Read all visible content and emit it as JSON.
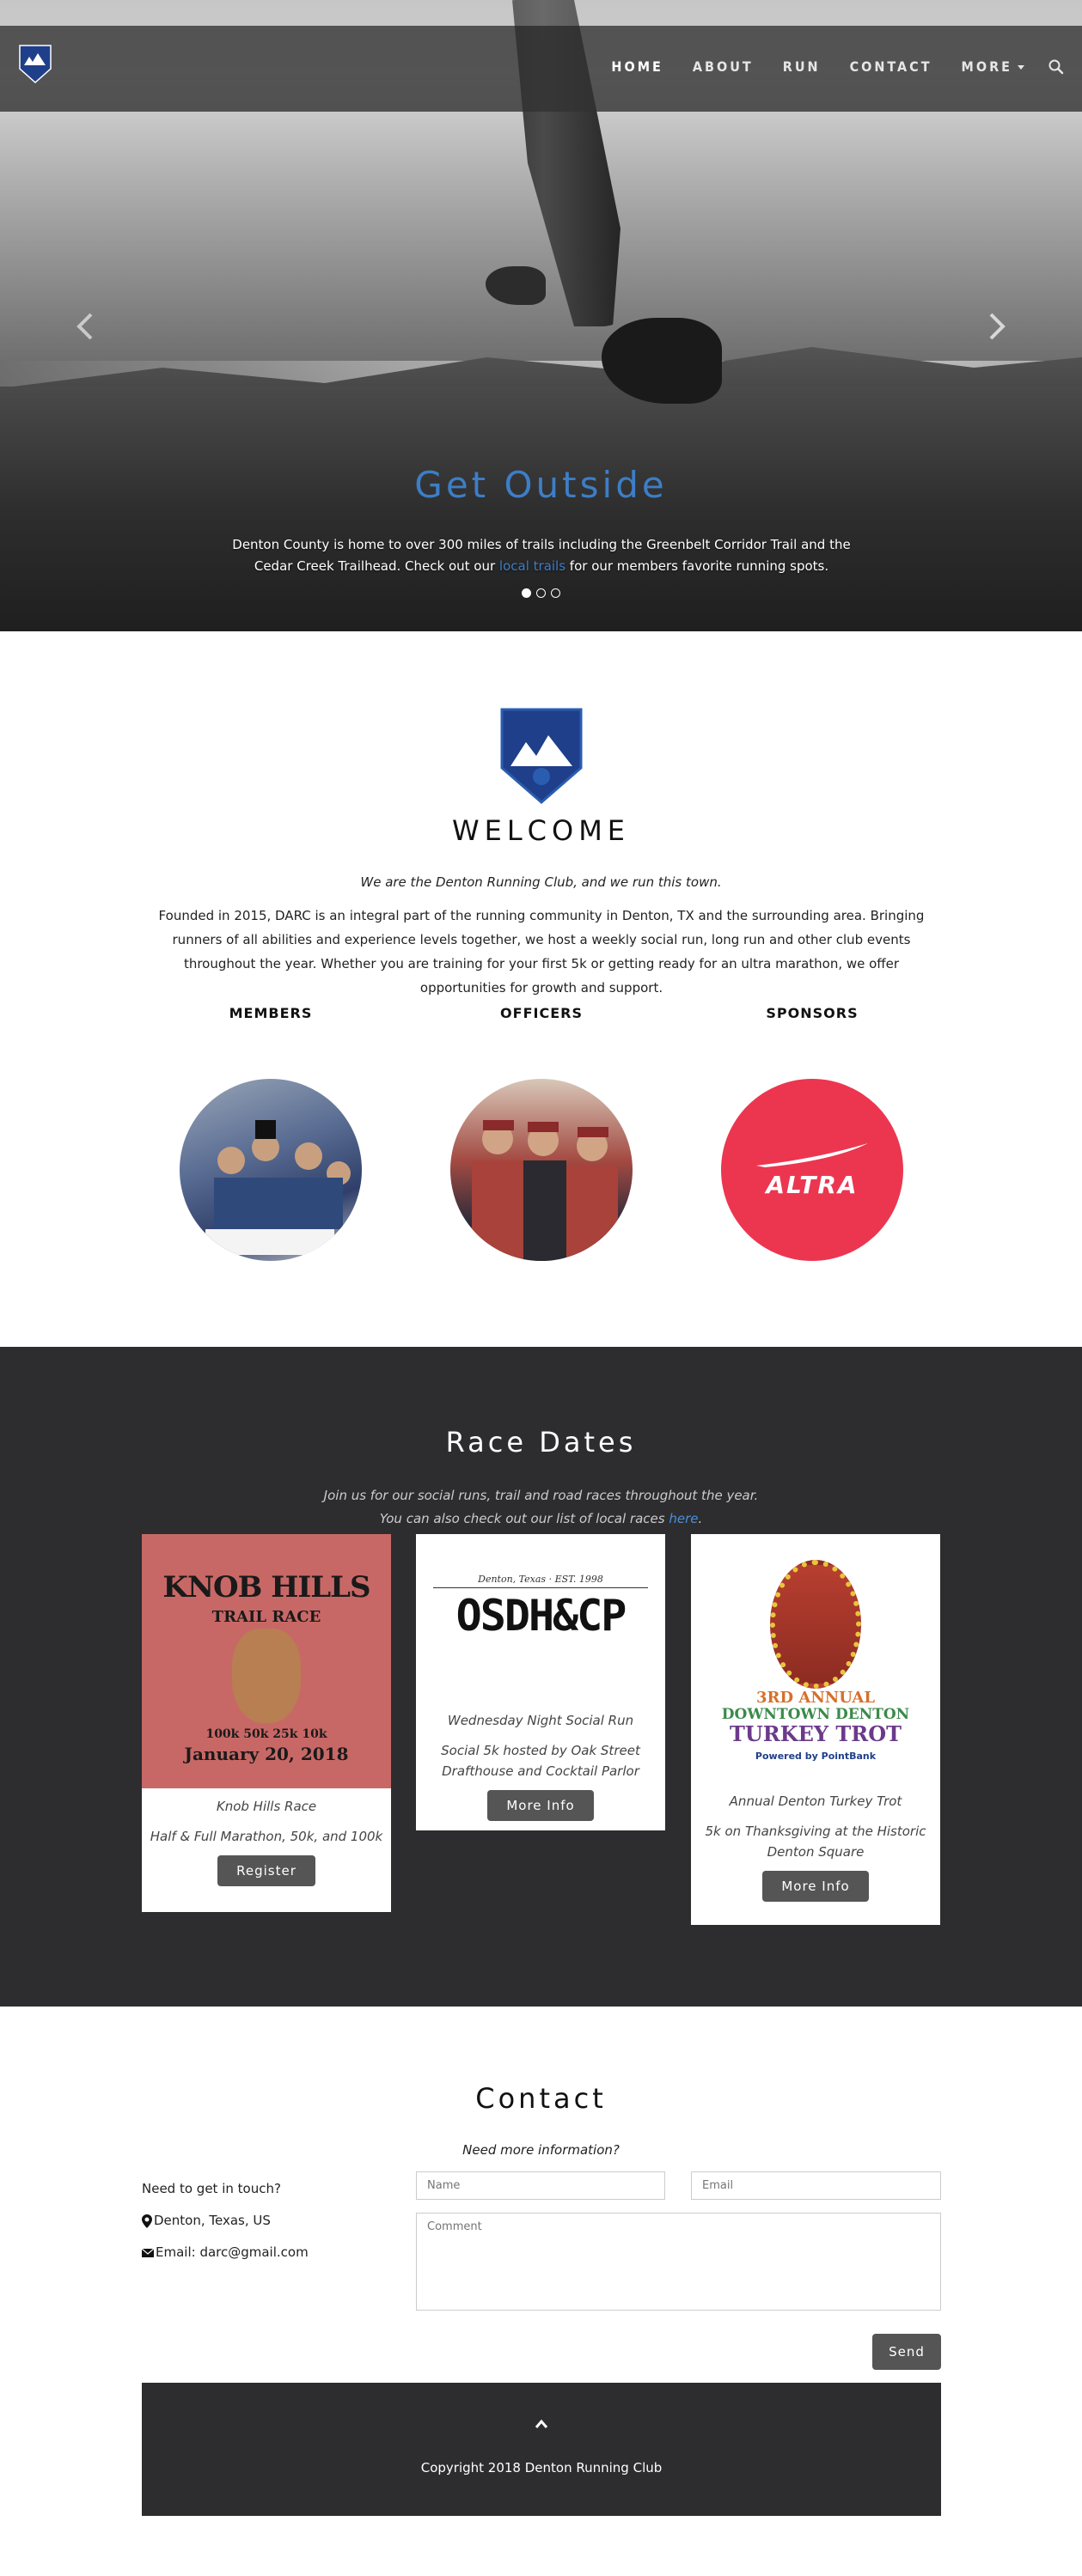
{
  "nav": {
    "links": [
      {
        "label": "HOME",
        "active": true
      },
      {
        "label": "ABOUT"
      },
      {
        "label": "RUN"
      },
      {
        "label": "CONTACT"
      },
      {
        "label": "MORE"
      }
    ],
    "search_icon": "search-icon",
    "logo_icon": "darc-logo"
  },
  "hero": {
    "title": "Get Outside",
    "caption_before": "Denton County is home to over 300 miles of trails including the Greenbelt Corridor Trail and the Cedar Creek Trailhead. Check out our ",
    "caption_link": "local trails",
    "caption_after": " for our members favorite running spots.",
    "slides": 3,
    "active_slide": 1
  },
  "welcome": {
    "title": "WELCOME",
    "tagline": "We are the Denton Running Club, and we run this town.",
    "body": "Founded in 2015, DARC is an integral part of the running community in Denton, TX and the surrounding area. Bringing runners of all abilities and experience levels together, we host a weekly social run, long run and other club events throughout the year. Whether you are training for your first 5k or getting ready for an ultra marathon, we offer opportunities for growth and support.",
    "columns": [
      {
        "heading": "MEMBERS"
      },
      {
        "heading": "OFFICERS"
      },
      {
        "heading": "SPONSORS",
        "logo_text": "ALTRA"
      }
    ]
  },
  "races": {
    "title": "Race Dates",
    "sub_line1": "Join us for our social runs, trail and road races throughout the year.",
    "sub_line2_before": "You can also check out our list of local races ",
    "sub_line2_link": "here",
    "sub_line2_after": ".",
    "cards": [
      {
        "poster": {
          "title": "KNOB HILLS",
          "subtitle": "TRAIL RACE",
          "distances": "100k 50k 25k 10k",
          "date": "January 20, 2018"
        },
        "name": "Knob Hills Race",
        "desc": "Half & Full Marathon, 50k, and 100k",
        "button": "Register"
      },
      {
        "poster": {
          "top": "Denton, Texas",
          "est": "EST. 1998",
          "name": "OSDH&CP"
        },
        "name": "Wednesday Night Social Run",
        "desc": "Social 5k hosted by Oak Street Drafthouse and Cocktail Parlor",
        "button": "More Info"
      },
      {
        "poster": {
          "line1": "3RD ANNUAL",
          "line2": "DOWNTOWN DENTON",
          "line3": "TURKEY TROT",
          "sponsor": "Powered by PointBank"
        },
        "name": "Annual Denton Turkey Trot",
        "desc": "5k on Thanksgiving at the Historic Denton Square",
        "button": "More Info"
      }
    ]
  },
  "contact": {
    "title": "Contact",
    "tagline": "Need more information?",
    "prompt": "Need to get in touch?",
    "location": "Denton, Texas, US",
    "email": "Email: darc@gmail.com",
    "name_placeholder": "Name",
    "email_placeholder": "Email",
    "comment_placeholder": "Comment",
    "send": "Send"
  },
  "footer": {
    "copyright": "Copyright 2018 Denton Running Club"
  },
  "colors": {
    "accent": "#3d7ec7",
    "dark": "#2d2d2f",
    "button": "#555555",
    "sponsor_red": "#ec3650"
  }
}
